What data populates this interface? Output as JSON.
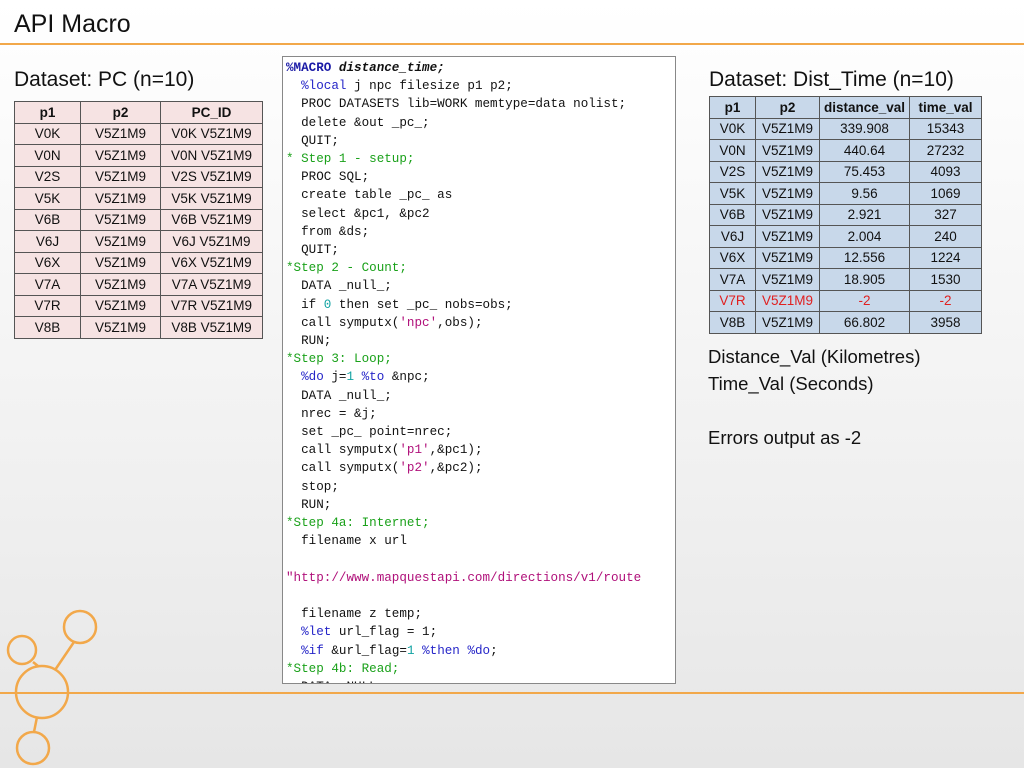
{
  "slide": {
    "title": "API Macro"
  },
  "pc_dataset": {
    "heading": "Dataset: PC (n=10)",
    "columns": [
      "p1",
      "p2",
      "PC_ID"
    ],
    "rows": [
      [
        "V0K",
        "V5Z1M9",
        "V0K V5Z1M9"
      ],
      [
        "V0N",
        "V5Z1M9",
        "V0N V5Z1M9"
      ],
      [
        "V2S",
        "V5Z1M9",
        "V2S V5Z1M9"
      ],
      [
        "V5K",
        "V5Z1M9",
        "V5K V5Z1M9"
      ],
      [
        "V6B",
        "V5Z1M9",
        "V6B V5Z1M9"
      ],
      [
        "V6J",
        "V5Z1M9",
        "V6J V5Z1M9"
      ],
      [
        "V6X",
        "V5Z1M9",
        "V6X V5Z1M9"
      ],
      [
        "V7A",
        "V5Z1M9",
        "V7A V5Z1M9"
      ],
      [
        "V7R",
        "V5Z1M9",
        "V7R V5Z1M9"
      ],
      [
        "V8B",
        "V5Z1M9",
        "V8B V5Z1M9"
      ]
    ]
  },
  "dist_time_dataset": {
    "heading": "Dataset: Dist_Time (n=10)",
    "columns": [
      "p1",
      "p2",
      "distance_val",
      "time_val"
    ],
    "rows": [
      [
        "V0K",
        "V5Z1M9",
        "339.908",
        "15343"
      ],
      [
        "V0N",
        "V5Z1M9",
        "440.64",
        "27232"
      ],
      [
        "V2S",
        "V5Z1M9",
        "75.453",
        "4093"
      ],
      [
        "V5K",
        "V5Z1M9",
        "9.56",
        "1069"
      ],
      [
        "V6B",
        "V5Z1M9",
        "2.921",
        "327"
      ],
      [
        "V6J",
        "V5Z1M9",
        "2.004",
        "240"
      ],
      [
        "V6X",
        "V5Z1M9",
        "12.556",
        "1224"
      ],
      [
        "V7A",
        "V5Z1M9",
        "18.905",
        "1530"
      ],
      [
        "V7R",
        "V5Z1M9",
        "-2",
        "-2"
      ],
      [
        "V8B",
        "V5Z1M9",
        "66.802",
        "3958"
      ]
    ],
    "error_row_color": "#e02020"
  },
  "code": {
    "lines": [
      [
        [
          "kw-macro",
          "%MACRO "
        ],
        [
          "bi",
          "distance_time;"
        ]
      ],
      [
        [
          "",
          "  "
        ],
        [
          "kw-blue",
          "%local"
        ],
        [
          "",
          " j npc filesize p1 p2;"
        ]
      ],
      [
        [
          "",
          "  PROC DATASETS lib=WORK memtype=data nolist;"
        ]
      ],
      [
        [
          "",
          "  delete &out _pc_;"
        ]
      ],
      [
        [
          "",
          "  QUIT;"
        ]
      ],
      [
        [
          "cm",
          "* Step 1 - setup;"
        ]
      ],
      [
        [
          "",
          "  PROC SQL;"
        ]
      ],
      [
        [
          "",
          "  create table _pc_ as"
        ]
      ],
      [
        [
          "",
          "  select &pc1, &pc2"
        ]
      ],
      [
        [
          "",
          "  from &ds;"
        ]
      ],
      [
        [
          "",
          "  QUIT;"
        ]
      ],
      [
        [
          "cm",
          "*Step 2 - Count;"
        ]
      ],
      [
        [
          "",
          "  DATA _null_;"
        ]
      ],
      [
        [
          "",
          "  if "
        ],
        [
          "num",
          "0"
        ],
        [
          "",
          " then set _pc_ nobs=obs;"
        ]
      ],
      [
        [
          "",
          "  call symputx("
        ],
        [
          "str",
          "'npc'"
        ],
        [
          "",
          ",obs);"
        ]
      ],
      [
        [
          "",
          "  RUN;"
        ]
      ],
      [
        [
          "cm",
          "*Step 3: Loop;"
        ]
      ],
      [
        [
          "",
          "  "
        ],
        [
          "kw-blue",
          "%do"
        ],
        [
          "",
          " j="
        ],
        [
          "num",
          "1"
        ],
        [
          "",
          " "
        ],
        [
          "kw-blue",
          "%to"
        ],
        [
          "",
          " &npc;"
        ]
      ],
      [
        [
          "",
          "  DATA _null_;"
        ]
      ],
      [
        [
          "",
          "  nrec = &j;"
        ]
      ],
      [
        [
          "",
          "  set _pc_ point=nrec;"
        ]
      ],
      [
        [
          "",
          "  call symputx("
        ],
        [
          "str",
          "'p1'"
        ],
        [
          "",
          ",&pc1);"
        ]
      ],
      [
        [
          "",
          "  call symputx("
        ],
        [
          "str",
          "'p2'"
        ],
        [
          "",
          ",&pc2);"
        ]
      ],
      [
        [
          "",
          "  stop;"
        ]
      ],
      [
        [
          "",
          "  RUN;"
        ]
      ],
      [
        [
          "cm",
          "*Step 4a: Internet;"
        ]
      ],
      [
        [
          "",
          "  filename x url"
        ]
      ],
      [
        [
          "",
          ""
        ]
      ],
      [
        [
          "str",
          "\"http://www.mapquestapi.com/directions/v1/route"
        ]
      ],
      [
        [
          "",
          ""
        ]
      ],
      [
        [
          "",
          "  filename z temp;"
        ]
      ],
      [
        [
          "",
          "  "
        ],
        [
          "kw-blue",
          "%let"
        ],
        [
          "",
          " url_flag = 1;"
        ]
      ],
      [
        [
          "",
          "  "
        ],
        [
          "kw-blue",
          "%if"
        ],
        [
          "",
          " &url_flag="
        ],
        [
          "num",
          "1"
        ],
        [
          "",
          " "
        ],
        [
          "kw-blue",
          "%then"
        ],
        [
          "",
          " "
        ],
        [
          "kw-blue",
          "%do"
        ],
        [
          "",
          ";"
        ]
      ],
      [
        [
          "cm",
          "*Step 4b: Read;"
        ]
      ],
      [
        [
          "",
          "  DATA _NULL_;"
        ]
      ]
    ]
  },
  "notes": {
    "lines": [
      "Distance_Val (Kilometres)",
      "Time_Val (Seconds)",
      "",
      "Errors output as -2"
    ]
  },
  "theme": {
    "accent": "#f2a84a"
  }
}
